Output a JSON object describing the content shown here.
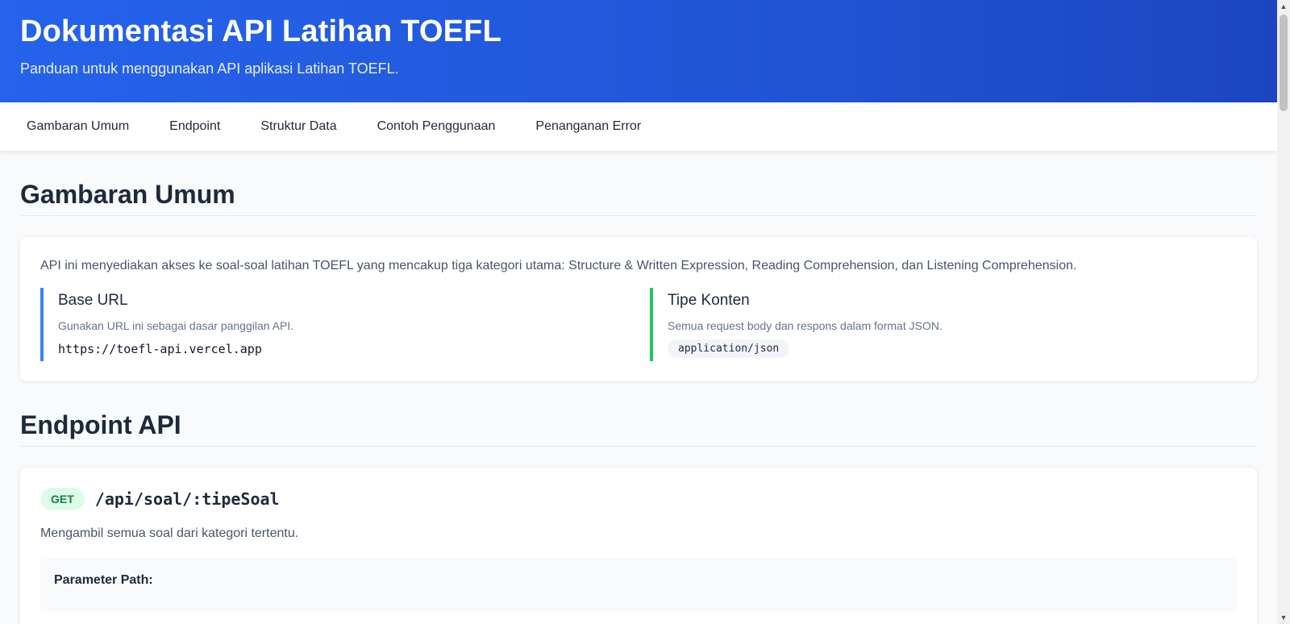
{
  "header": {
    "title": "Dokumentasi API Latihan TOEFL",
    "subtitle": "Panduan untuk menggunakan API aplikasi Latihan TOEFL."
  },
  "nav": {
    "items": [
      {
        "label": "Gambaran Umum"
      },
      {
        "label": "Endpoint"
      },
      {
        "label": "Struktur Data"
      },
      {
        "label": "Contoh Penggunaan"
      },
      {
        "label": "Penanganan Error"
      }
    ]
  },
  "overview": {
    "title": "Gambaran Umum",
    "description": "API ini menyediakan akses ke soal-soal latihan TOEFL yang mencakup tiga kategori utama: Structure & Written Expression, Reading Comprehension, dan Listening Comprehension.",
    "base_url": {
      "title": "Base URL",
      "description": "Gunakan URL ini sebagai dasar panggilan API.",
      "value": "https://toefl-api.vercel.app"
    },
    "content_type": {
      "title": "Tipe Konten",
      "description": "Semua request body dan respons dalam format JSON.",
      "value": "application/json"
    }
  },
  "endpoints": {
    "title": "Endpoint API",
    "items": [
      {
        "method": "GET",
        "path": "/api/soal/:tipeSoal",
        "description": "Mengambil semua soal dari kategori tertentu.",
        "params_title": "Parameter Path:"
      }
    ]
  },
  "colors": {
    "header_gradient_start": "#2563eb",
    "header_gradient_end": "#1d45c2",
    "base_url_accent": "#3b82f6",
    "content_type_accent": "#22c55e",
    "method_get_bg": "#dcfce7",
    "method_get_text": "#15803d"
  },
  "scrollbar": {
    "up_icon": "triangle-up-icon",
    "down_icon": "triangle-down-icon"
  }
}
